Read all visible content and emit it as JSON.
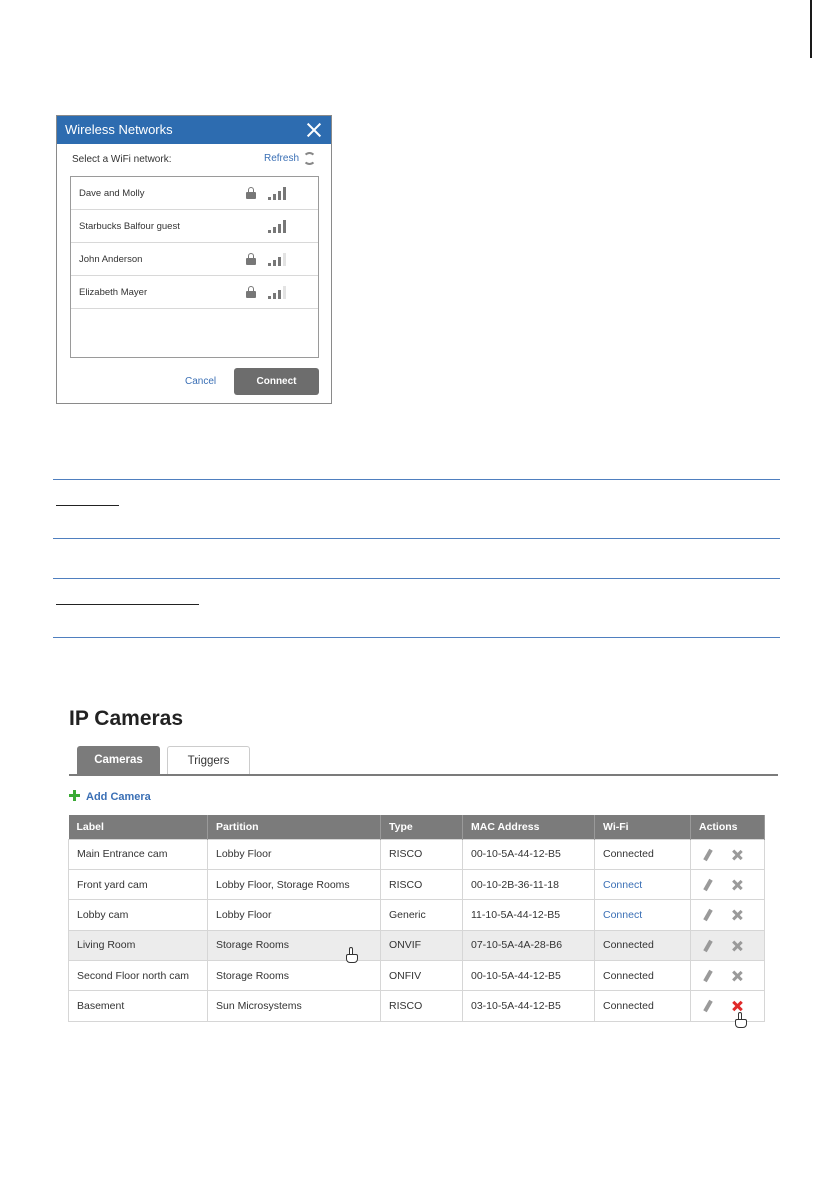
{
  "wifi_dialog": {
    "title": "Wireless Networks",
    "prompt": "Select a WiFi network:",
    "refresh_label": "Refresh",
    "networks": [
      {
        "name": "Dave and Molly",
        "locked": true,
        "signal_bars": 4
      },
      {
        "name": "Starbucks Balfour guest",
        "locked": false,
        "signal_bars": 4
      },
      {
        "name": "John Anderson",
        "locked": true,
        "signal_bars": 3
      },
      {
        "name": "Elizabeth Mayer",
        "locked": true,
        "signal_bars": 3
      }
    ],
    "cancel_label": "Cancel",
    "connect_label": "Connect",
    "colors": {
      "header": "#2d6cb0",
      "link": "#3a6fb5",
      "button": "#6d6d6d"
    }
  },
  "ip_cameras": {
    "title": "IP Cameras",
    "tabs": [
      {
        "label": "Cameras",
        "active": true
      },
      {
        "label": "Triggers",
        "active": false
      }
    ],
    "add_camera_label": "Add Camera",
    "columns": [
      "Label",
      "Partition",
      "Type",
      "MAC Address",
      "Wi-Fi",
      "Actions"
    ],
    "rows": [
      {
        "label": "Main Entrance cam",
        "partition": "Lobby Floor",
        "type": "RISCO",
        "mac": "00-10-5A-44-12-B5",
        "wifi": "Connected",
        "wifi_is_link": false,
        "highlighted": false
      },
      {
        "label": "Front yard cam",
        "partition": "Lobby Floor, Storage Rooms",
        "type": "RISCO",
        "mac": "00-10-2B-36-11-18",
        "wifi": "Connect",
        "wifi_is_link": true,
        "highlighted": false
      },
      {
        "label": "Lobby cam",
        "partition": "Lobby Floor",
        "type": "Generic",
        "mac": "11-10-5A-44-12-B5",
        "wifi": "Connect",
        "wifi_is_link": true,
        "highlighted": false
      },
      {
        "label": "Living Room",
        "partition": "Storage Rooms",
        "type": "ONVIF",
        "mac": "07-10-5A-4A-28-B6",
        "wifi": "Connected",
        "wifi_is_link": false,
        "highlighted": true
      },
      {
        "label": "Second Floor north cam",
        "partition": "Storage Rooms",
        "type": "ONFIV",
        "mac": "00-10-5A-44-12-B5",
        "wifi": "Connected",
        "wifi_is_link": false,
        "highlighted": false
      },
      {
        "label": "Basement",
        "partition": "Sun Microsystems",
        "type": "RISCO",
        "mac": "03-10-5A-44-12-B5",
        "wifi": "Connected",
        "wifi_is_link": false,
        "highlighted": false
      }
    ],
    "colors": {
      "header": "#7b7b7b",
      "link": "#3a6fb5",
      "add_icon": "#3aaa35",
      "delete_active": "#e02a2a"
    }
  }
}
